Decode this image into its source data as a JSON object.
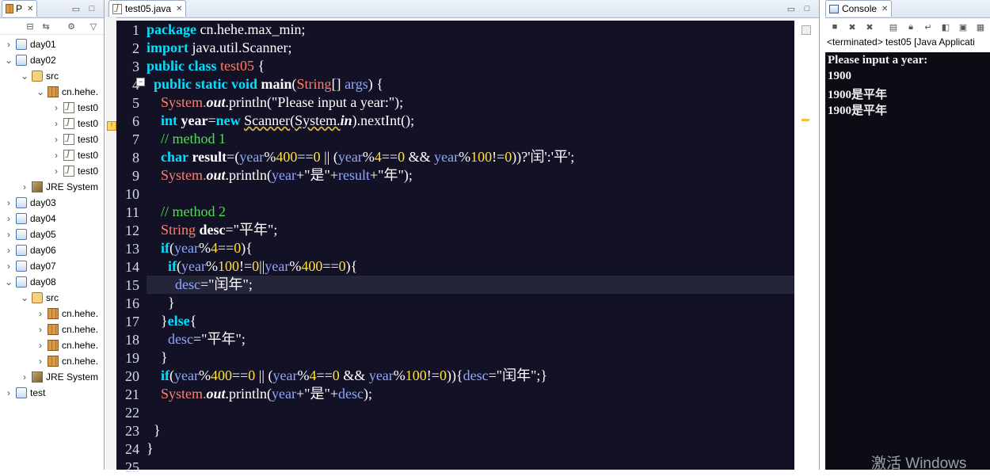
{
  "explorer": {
    "tab_label": "P",
    "tree": [
      {
        "label": "day01",
        "type": "project",
        "level": 0,
        "expanded": false
      },
      {
        "label": "day02",
        "type": "project",
        "level": 0,
        "expanded": true
      },
      {
        "label": "src",
        "type": "src",
        "level": 1,
        "expanded": true
      },
      {
        "label": "cn.hehe.",
        "type": "package",
        "level": 2,
        "expanded": true
      },
      {
        "label": "test0",
        "type": "java",
        "level": 3,
        "expanded": false
      },
      {
        "label": "test0",
        "type": "java",
        "level": 3,
        "expanded": false
      },
      {
        "label": "test0",
        "type": "java",
        "level": 3,
        "expanded": false
      },
      {
        "label": "test0",
        "type": "java",
        "level": 3,
        "expanded": false
      },
      {
        "label": "test0",
        "type": "java",
        "level": 3,
        "expanded": false
      },
      {
        "label": "JRE System",
        "type": "lib",
        "level": 1,
        "expanded": false
      },
      {
        "label": "day03",
        "type": "project",
        "level": 0,
        "expanded": false
      },
      {
        "label": "day04",
        "type": "project",
        "level": 0,
        "expanded": false
      },
      {
        "label": "day05",
        "type": "project",
        "level": 0,
        "expanded": false
      },
      {
        "label": "day06",
        "type": "project",
        "level": 0,
        "expanded": false
      },
      {
        "label": "day07",
        "type": "project",
        "level": 0,
        "expanded": false
      },
      {
        "label": "day08",
        "type": "project",
        "level": 0,
        "expanded": true
      },
      {
        "label": "src",
        "type": "src",
        "level": 1,
        "expanded": true
      },
      {
        "label": "cn.hehe.",
        "type": "package",
        "level": 2,
        "expanded": false
      },
      {
        "label": "cn.hehe.",
        "type": "package",
        "level": 2,
        "expanded": false
      },
      {
        "label": "cn.hehe.",
        "type": "package",
        "level": 2,
        "expanded": false
      },
      {
        "label": "cn.hehe.",
        "type": "package",
        "level": 2,
        "expanded": false
      },
      {
        "label": "JRE System",
        "type": "lib",
        "level": 1,
        "expanded": false
      },
      {
        "label": "test",
        "type": "project",
        "level": 0,
        "expanded": false
      }
    ]
  },
  "editor": {
    "tab_label": "test05.java",
    "line_numbers": [
      "1",
      "2",
      "3",
      "4",
      "5",
      "6",
      "7",
      "8",
      "9",
      "10",
      "11",
      "12",
      "13",
      "14",
      "15",
      "16",
      "17",
      "18",
      "19",
      "20",
      "21",
      "22",
      "23",
      "24",
      "25"
    ],
    "lines": [
      [
        [
          "k",
          "package"
        ],
        [
          "w",
          " cn.hehe.max_min;"
        ]
      ],
      [
        [
          "k",
          "import"
        ],
        [
          "w",
          " java.util.Scanner;"
        ]
      ],
      [
        [
          "k",
          "public class"
        ],
        [
          "w",
          " "
        ],
        [
          "cls",
          "test05"
        ],
        [
          "w",
          " {"
        ]
      ],
      [
        [
          "w",
          "  "
        ],
        [
          "k",
          "public static void"
        ],
        [
          "w",
          " "
        ],
        [
          "b",
          "main"
        ],
        [
          "w",
          "("
        ],
        [
          "cls",
          "String"
        ],
        [
          "w",
          "[] "
        ],
        [
          "v",
          "args"
        ],
        [
          "w",
          ") {"
        ]
      ],
      [
        [
          "w",
          "    "
        ],
        [
          "cls",
          "System."
        ],
        [
          "ital",
          "out"
        ],
        [
          "w",
          ".println(\"Please input a year:\");"
        ]
      ],
      [
        [
          "w",
          "    "
        ],
        [
          "k",
          "int"
        ],
        [
          "w",
          " "
        ],
        [
          "b",
          "year"
        ],
        [
          "w",
          "="
        ],
        [
          "k",
          "new"
        ],
        [
          "w",
          " "
        ],
        [
          "ul",
          "Scanner"
        ],
        [
          "w",
          "("
        ],
        [
          "ul",
          "System."
        ],
        [
          "ital",
          "in"
        ],
        [
          "w",
          ").nextInt();"
        ]
      ],
      [
        [
          "w",
          "    "
        ],
        [
          "cmt",
          "// method 1"
        ]
      ],
      [
        [
          "w",
          "    "
        ],
        [
          "k",
          "char"
        ],
        [
          "w",
          " "
        ],
        [
          "b",
          "result"
        ],
        [
          "w",
          "=("
        ],
        [
          "v",
          "year"
        ],
        [
          "w",
          "%"
        ],
        [
          "num",
          "400"
        ],
        [
          "w",
          "=="
        ],
        [
          "num",
          "0"
        ],
        [
          "w",
          " || ("
        ],
        [
          "v",
          "year"
        ],
        [
          "w",
          "%"
        ],
        [
          "num",
          "4"
        ],
        [
          "w",
          "=="
        ],
        [
          "num",
          "0"
        ],
        [
          "w",
          " && "
        ],
        [
          "v",
          "year"
        ],
        [
          "w",
          "%"
        ],
        [
          "num",
          "100"
        ],
        [
          "w",
          "!="
        ],
        [
          "num",
          "0"
        ],
        [
          "w",
          "))?'闰':'平';"
        ]
      ],
      [
        [
          "w",
          "    "
        ],
        [
          "cls",
          "System."
        ],
        [
          "ital",
          "out"
        ],
        [
          "w",
          ".println("
        ],
        [
          "v",
          "year"
        ],
        [
          "w",
          "+\"是\"+"
        ],
        [
          "v",
          "result"
        ],
        [
          "w",
          "+\"年\");"
        ]
      ],
      [],
      [
        [
          "w",
          "    "
        ],
        [
          "cmt",
          "// method 2"
        ]
      ],
      [
        [
          "w",
          "    "
        ],
        [
          "cls",
          "String"
        ],
        [
          "w",
          " "
        ],
        [
          "b",
          "desc"
        ],
        [
          "w",
          "=\"平年\";"
        ]
      ],
      [
        [
          "w",
          "    "
        ],
        [
          "k",
          "if"
        ],
        [
          "w",
          "("
        ],
        [
          "v",
          "year"
        ],
        [
          "w",
          "%"
        ],
        [
          "num",
          "4"
        ],
        [
          "w",
          "=="
        ],
        [
          "num",
          "0"
        ],
        [
          "w",
          "){"
        ]
      ],
      [
        [
          "w",
          "      "
        ],
        [
          "k",
          "if"
        ],
        [
          "w",
          "("
        ],
        [
          "v",
          "year"
        ],
        [
          "w",
          "%"
        ],
        [
          "num",
          "100"
        ],
        [
          "w",
          "!="
        ],
        [
          "num",
          "0"
        ],
        [
          "w",
          "||"
        ],
        [
          "v",
          "year"
        ],
        [
          "w",
          "%"
        ],
        [
          "num",
          "400"
        ],
        [
          "w",
          "=="
        ],
        [
          "num",
          "0"
        ],
        [
          "w",
          "){"
        ]
      ],
      [
        [
          "w",
          "        "
        ],
        [
          "v",
          "desc"
        ],
        [
          "w",
          "=\"闰年\";"
        ]
      ],
      [
        [
          "w",
          "      }"
        ]
      ],
      [
        [
          "w",
          "    }"
        ],
        [
          "k",
          "else"
        ],
        [
          "w",
          "{"
        ]
      ],
      [
        [
          "w",
          "      "
        ],
        [
          "v",
          "desc"
        ],
        [
          "w",
          "=\"平年\";"
        ]
      ],
      [
        [
          "w",
          "    }"
        ]
      ],
      [
        [
          "w",
          "    "
        ],
        [
          "k",
          "if"
        ],
        [
          "w",
          "("
        ],
        [
          "v",
          "year"
        ],
        [
          "w",
          "%"
        ],
        [
          "num",
          "400"
        ],
        [
          "w",
          "=="
        ],
        [
          "num",
          "0"
        ],
        [
          "w",
          " || ("
        ],
        [
          "v",
          "year"
        ],
        [
          "w",
          "%"
        ],
        [
          "num",
          "4"
        ],
        [
          "w",
          "=="
        ],
        [
          "num",
          "0"
        ],
        [
          "w",
          " && "
        ],
        [
          "v",
          "year"
        ],
        [
          "w",
          "%"
        ],
        [
          "num",
          "100"
        ],
        [
          "w",
          "!="
        ],
        [
          "num",
          "0"
        ],
        [
          "w",
          "))"
        ],
        [
          "w",
          "{"
        ],
        [
          "v",
          "desc"
        ],
        [
          "w",
          "=\"闰年\";}"
        ]
      ],
      [
        [
          "w",
          "    "
        ],
        [
          "cls",
          "System."
        ],
        [
          "ital",
          "out"
        ],
        [
          "w",
          ".println("
        ],
        [
          "v",
          "year"
        ],
        [
          "w",
          "+\"是\"+"
        ],
        [
          "v",
          "desc"
        ],
        [
          "w",
          ");"
        ]
      ],
      [],
      [
        [
          "w",
          "  }"
        ]
      ],
      [
        [
          "w",
          "}"
        ]
      ],
      []
    ],
    "current_line": 15
  },
  "console": {
    "tab_label": "Console",
    "status": "<terminated> test05 [Java Applicati",
    "output": [
      "Please input a year:",
      "1900",
      "1900是平年",
      "1900是平年"
    ]
  },
  "watermark": "激活 Windows"
}
